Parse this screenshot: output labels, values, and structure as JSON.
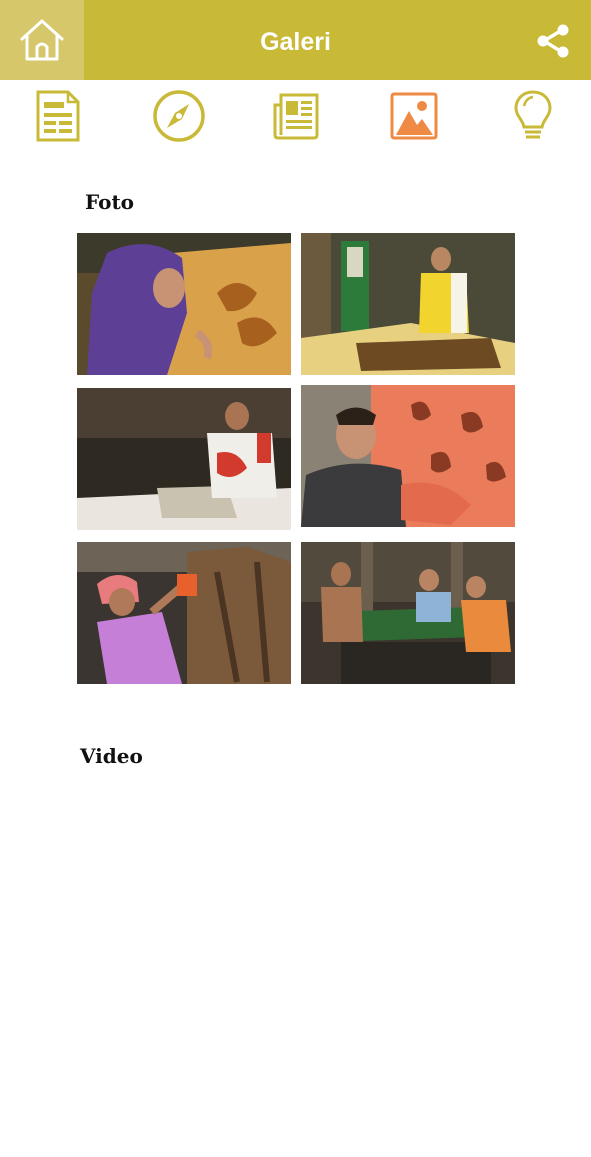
{
  "header": {
    "title": "Galeri",
    "home_icon": "home-icon",
    "share_icon": "share-icon",
    "color": "#c8b937"
  },
  "tabs": [
    {
      "icon": "document-icon",
      "active": false
    },
    {
      "icon": "compass-icon",
      "active": false
    },
    {
      "icon": "newspaper-icon",
      "active": false
    },
    {
      "icon": "image-icon",
      "active": true
    },
    {
      "icon": "lightbulb-icon",
      "active": false
    }
  ],
  "colors": {
    "tab_icon": "#c8b937",
    "tab_active": "#ef8a45"
  },
  "photos_section": {
    "title": "Foto",
    "photos": [
      {
        "subject": "woman-in-purple-hijab-drawing-batik"
      },
      {
        "subject": "man-in-yellow-shirt-stamping-batik"
      },
      {
        "subject": "man-in-white-shirt-waxing-cloth"
      },
      {
        "subject": "woman-with-orange-batik-cloth"
      },
      {
        "subject": "worker-hanging-brown-batik"
      },
      {
        "subject": "workers-rolling-green-cloth"
      }
    ]
  },
  "video_section": {
    "title": "Video"
  }
}
